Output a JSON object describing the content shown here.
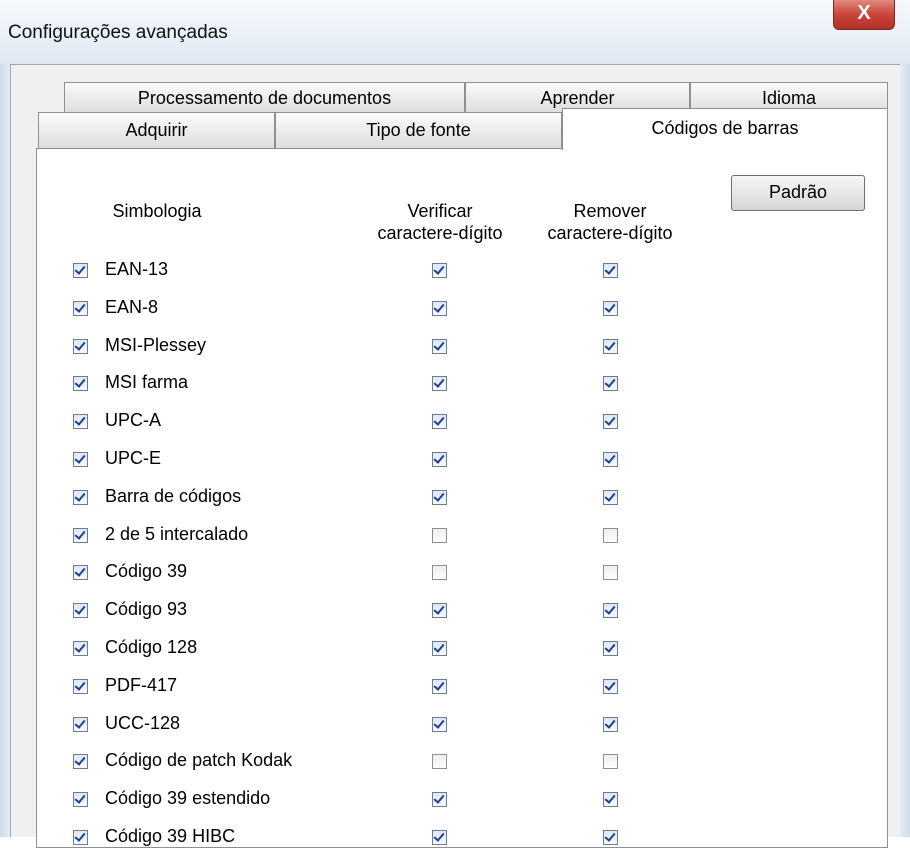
{
  "window": {
    "title": "Configurações avançadas",
    "close_glyph": "X"
  },
  "tabs": {
    "row1": [
      {
        "label": "Processamento de documentos"
      },
      {
        "label": "Aprender"
      },
      {
        "label": "Idioma"
      }
    ],
    "row2": [
      {
        "label": "Adquirir"
      },
      {
        "label": "Tipo de fonte"
      },
      {
        "label": "Códigos de barras",
        "active": true
      }
    ]
  },
  "barcodes": {
    "default_button": "Padrão",
    "columns": {
      "symbology": "Simbologia",
      "verify_line1": "Verificar",
      "verify_line2": "caractere-dígito",
      "remove_line1": "Remover",
      "remove_line2": "caractere-dígito"
    },
    "rows": [
      {
        "name": "EAN-13",
        "enabled": true,
        "verify": true,
        "remove": true
      },
      {
        "name": "EAN-8",
        "enabled": true,
        "verify": true,
        "remove": true
      },
      {
        "name": "MSI-Plessey",
        "enabled": true,
        "verify": true,
        "remove": true
      },
      {
        "name": "MSI farma",
        "enabled": true,
        "verify": true,
        "remove": true
      },
      {
        "name": "UPC-A",
        "enabled": true,
        "verify": true,
        "remove": true
      },
      {
        "name": "UPC-E",
        "enabled": true,
        "verify": true,
        "remove": true
      },
      {
        "name": "Barra de códigos",
        "enabled": true,
        "verify": true,
        "remove": true
      },
      {
        "name": "2 de 5 intercalado",
        "enabled": true,
        "verify": false,
        "remove": false
      },
      {
        "name": "Código 39",
        "enabled": true,
        "verify": false,
        "remove": false
      },
      {
        "name": "Código 93",
        "enabled": true,
        "verify": true,
        "remove": true
      },
      {
        "name": "Código 128",
        "enabled": true,
        "verify": true,
        "remove": true
      },
      {
        "name": "PDF-417",
        "enabled": true,
        "verify": true,
        "remove": true
      },
      {
        "name": "UCC-128",
        "enabled": true,
        "verify": true,
        "remove": true
      },
      {
        "name": "Código de patch Kodak",
        "enabled": true,
        "verify": false,
        "remove": false
      },
      {
        "name": "Código 39 estendido",
        "enabled": true,
        "verify": true,
        "remove": true
      },
      {
        "name": "Código 39 HIBC",
        "enabled": true,
        "verify": true,
        "remove": true
      }
    ]
  },
  "colors": {
    "check_mark": "#1c3f94",
    "close_button": "#c9453a",
    "panel_background": "#ffffff",
    "dialog_background": "#f0f0f0"
  }
}
